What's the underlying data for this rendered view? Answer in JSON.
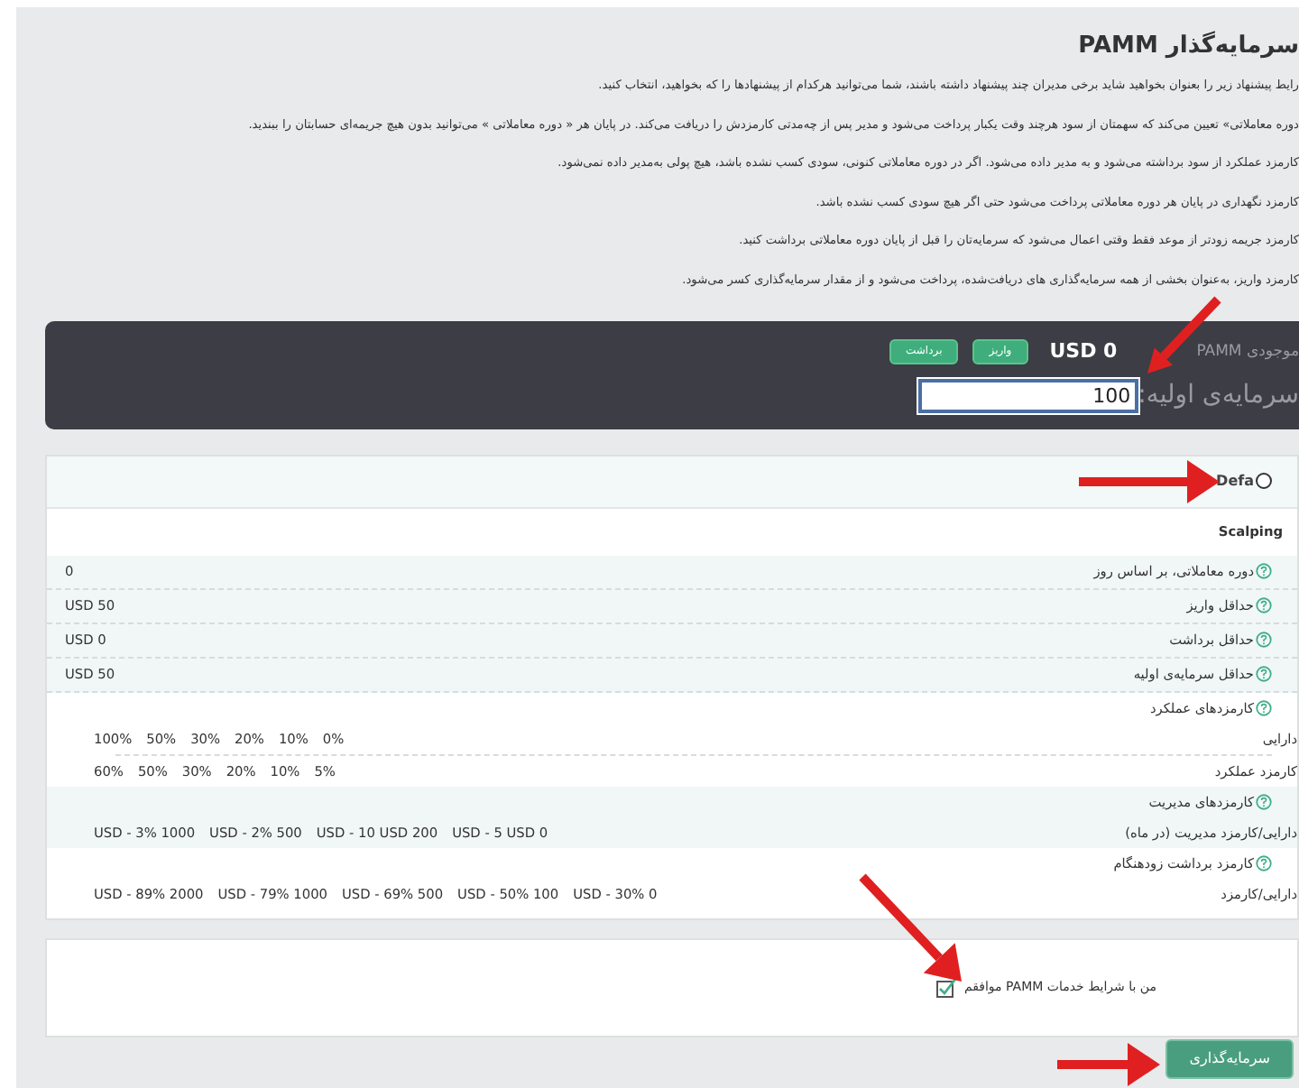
{
  "page_title": "سرمایه‌گذار PAMM",
  "intro_paragraphs": [
    "رایط پیشنهاد زیر را بعنوان بخواهید شاید برخی مدیران چند پیشنهاد داشته باشند، شما می‌توانید هرکدام از پیشنهادها را که بخواهید، انتخاب کنید.",
    "دوره معاملاتی» تعیین می‌کند که سهمتان از سود هرچند وقت یکبار پرداخت می‌شود و مدیر پس از چه‌مدتی کارمزدش را دریافت می‌کند. در پایان هر « دوره معاملاتی » می‌توانید بدون هیچ جریمه‌ای حسابتان را ببندید.",
    "کارمزد عملکرد از سود برداشته می‌شود و به مدیر داده می‌شود. اگر در دوره معاملاتی کنونی، سودی کسب نشده باشد، هیچ پولی به‌مدیر داده نمی‌شود.",
    "کارمزد نگهداری در پایان هر دوره معاملاتی پرداخت می‌شود حتی اگر هیچ سودی کسب نشده باشد.",
    "کارمزد جریمه زودتر از موعد فقط وقتی اعمال می‌شود که سرمایه‌تان را قبل از پایان دوره معاملاتی برداشت کنید.",
    "کارمزد واریز، به‌عنوان بخشی از همه سرمایه‌گذاری های دریافت‌شده، پرداخت می‌شود و از مقدار سرمایه‌گذاری کسر می‌شود."
  ],
  "balance": {
    "label": "موجودی PAMM",
    "amount": "USD 0",
    "buttons": [
      "واریز",
      "برداشت"
    ]
  },
  "initial_investment": {
    "label": "سرمایه‌ی اولیه:",
    "value": "100"
  },
  "offer": {
    "option": {
      "label": "Defa",
      "selected": false
    },
    "name": "Scalping",
    "rows": [
      {
        "label": "دوره معاملاتی، بر اساس روز",
        "value": "0"
      },
      {
        "label": "حداقل واریز",
        "value": "USD 50"
      },
      {
        "label": "حداقل برداشت",
        "value": "USD 0"
      },
      {
        "label": "حداقل سرمایه‌ی اولیه",
        "value": "USD 50"
      }
    ],
    "fee_sections": [
      {
        "title": "کارمزدهای عملکرد",
        "rows": [
          {
            "label": "دارایی",
            "values": [
              "0%",
              "10%",
              "20%",
              "30%",
              "50%",
              "100%"
            ]
          },
          {
            "label": "کارمزد عملکرد",
            "values": [
              "5%",
              "10%",
              "20%",
              "30%",
              "50%",
              "60%"
            ]
          }
        ]
      },
      {
        "title": "کارمزدهای مدیریت",
        "rows": [
          {
            "label": "دارایی/کارمزد مدیریت (در ماه)",
            "values": [
              "USD - 5 USD 0",
              "USD - 10 USD 200",
              "USD - 2% 500",
              "USD - 3% 1000"
            ]
          }
        ]
      },
      {
        "title": "کارمزد برداشت زودهنگام",
        "rows": [
          {
            "label": "دارایی/کارمزد",
            "values": [
              "USD - 30% 0",
              "USD - 50% 100",
              "USD - 69% 500",
              "USD - 79% 1000",
              "USD - 89% 2000"
            ]
          }
        ]
      }
    ]
  },
  "terms": {
    "label": "من با شرایط خدمات PAMM موافقم",
    "checked": true
  },
  "submit_button": "سرمایه‌گذاری"
}
